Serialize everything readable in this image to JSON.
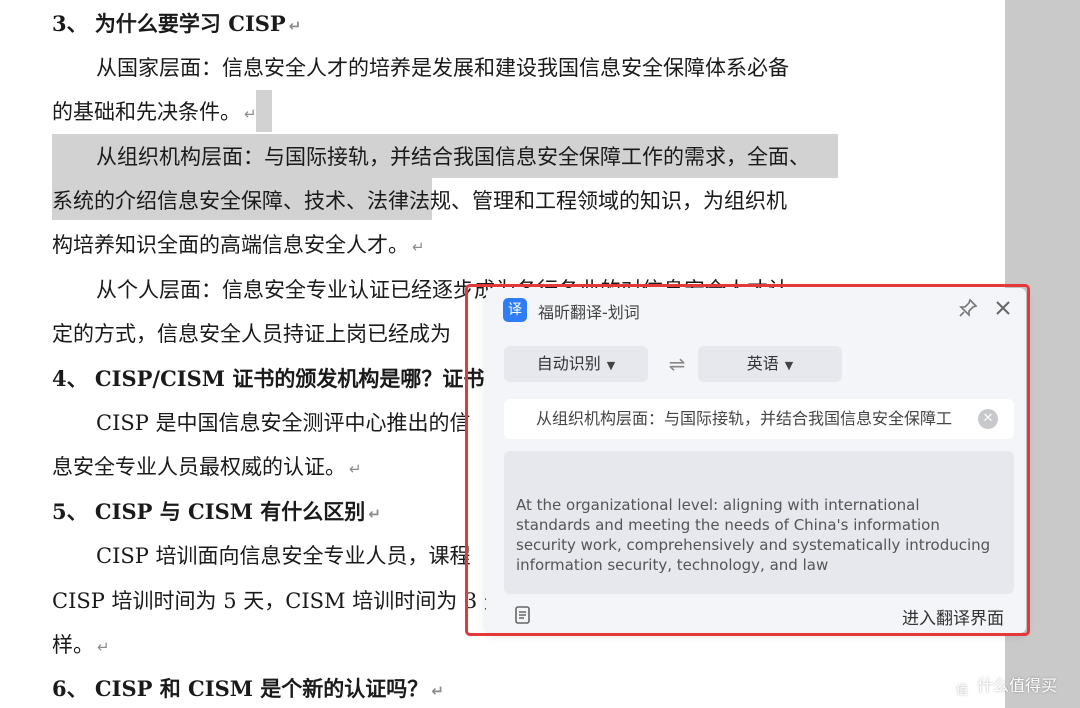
{
  "document": {
    "lines": [
      {
        "text": "3、 为什么要学习 CISP",
        "bold": true
      },
      {
        "text": "从国家层面：信息安全人才的培养是发展和建设我国信息安全保障体系必备"
      },
      {
        "text": "的基础和先决条件。"
      },
      {
        "text": "从组织机构层面：与国际接轨，并结合我国信息安全保障工作的需求，全面、"
      },
      {
        "text": "系统的介绍信息安全保障、技术、法律法规、管理和工程领域的知识，为组织机"
      },
      {
        "text": "构培养知识全面的高端信息安全人才。"
      },
      {
        "text": "从个人层面：信息安全专业认证已经逐步成为各行各业的对信息安全人才认"
      },
      {
        "text": "定的方式，信息安全人员持证上岗已经成为"
      },
      {
        "text": "4、 CISP/CISM 证书的颁发机构是哪？证书",
        "bold": true
      },
      {
        "text": "CISP 是中国信息安全测评中心推出的信"
      },
      {
        "text": "息安全专业人员最权威的认证。"
      },
      {
        "text": "5、 CISP 与 CISM 有什么区别",
        "bold": true
      },
      {
        "text": "CISP 培训面向信息安全专业人员，课程"
      },
      {
        "text": "CISP 培训时间为 5 天，CISM 培训时间为 3 天"
      },
      {
        "text": "样。"
      },
      {
        "text": "6、 CISP 和 CISM 是个新的认证吗？",
        "bold": true
      }
    ],
    "paragraph_mark": "↵"
  },
  "popup": {
    "logo_glyph": "译",
    "title": "福昕翻译-划词",
    "source_lang": "自动识别",
    "target_lang": "英语",
    "swap_symbol": "⇌",
    "source_text": "从组织机构层面：与国际接轨，并结合我国信息安全保障工",
    "result_lines": [
      "At the organizational level: aligning with international",
      "standards and meeting the needs of China's information",
      "security work, comprehensively and systematically introducing",
      "information security, technology, and law"
    ],
    "enter_label": "进入翻译界面",
    "icons": [
      "pin-icon",
      "close-icon",
      "caret-down-icon",
      "swap-icon",
      "clear-icon",
      "copy-icon"
    ]
  },
  "watermark": {
    "text": "什么值得买",
    "icon_glyph": "值"
  },
  "colors": {
    "highlight_border": "#e5383b",
    "logo_blue": "#2f7df6",
    "selection_gray": "#d2d2d2"
  }
}
